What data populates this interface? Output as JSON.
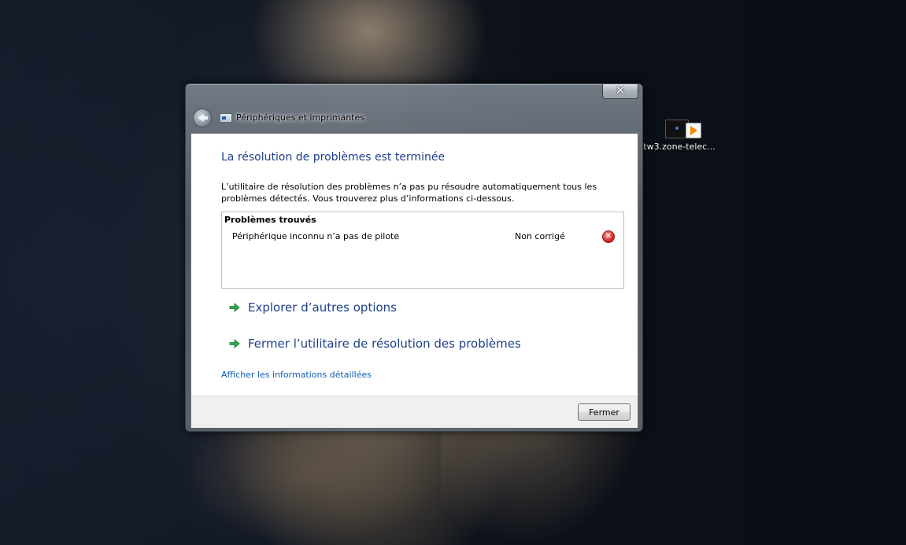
{
  "desktop": {
    "shortcut_label": "tw3.zone-telec..."
  },
  "window": {
    "title": "Périphériques et imprimantes",
    "close_glyph": "✕",
    "heading": "La résolution de problèmes est terminée",
    "description": "L’utilitaire de résolution des problèmes n’a pas pu résoudre automatiquement tous les problèmes détectés. Vous trouverez plus d’informations ci-dessous.",
    "problems": {
      "title": "Problèmes trouvés",
      "items": [
        {
          "name": "Périphérique inconnu n’a pas de pilote",
          "status": "Non corrigé",
          "icon": "error-icon"
        }
      ]
    },
    "options": [
      {
        "label": "Explorer d’autres options",
        "icon": "green-arrow-icon"
      },
      {
        "label": "Fermer l’utilitaire de résolution des problèmes",
        "icon": "green-arrow-icon"
      }
    ],
    "details_link": "Afficher les informations détaillées",
    "close_button_label": "Fermer"
  },
  "colors": {
    "heading": "#1e3f8a",
    "link": "#0d5db8",
    "arrow": "#2fa84f"
  }
}
